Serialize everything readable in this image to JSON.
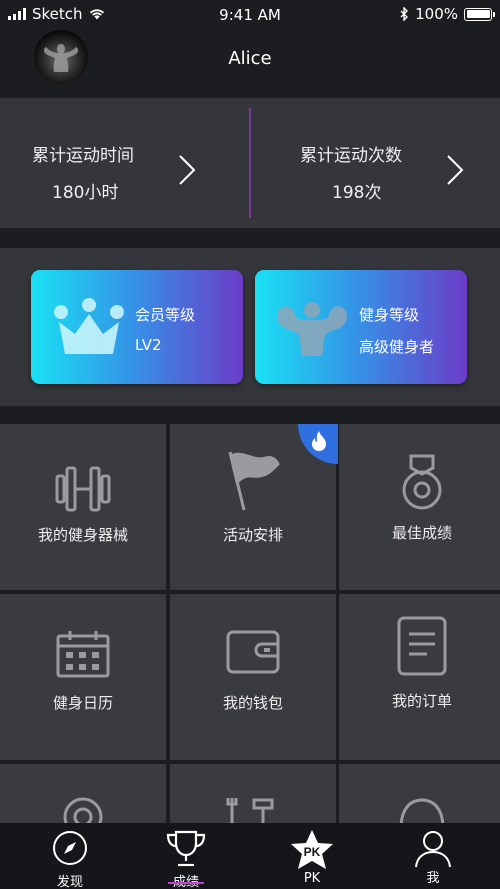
{
  "status_bar": {
    "carrier": "Sketch",
    "time": "9:41 AM",
    "battery": "100%"
  },
  "profile": {
    "name": "Alice"
  },
  "stats": [
    {
      "label": "累计运动时间",
      "value": "180小时"
    },
    {
      "label": "累计运动次数",
      "value": "198次"
    }
  ],
  "levels": [
    {
      "label": "会员等级",
      "value": "LV2",
      "icon": "crown-icon"
    },
    {
      "label": "健身等级",
      "value": "高级健身者",
      "icon": "bodybuilder-icon"
    }
  ],
  "grid": [
    {
      "label": "我的健身器械",
      "icon": "dumbbell-icon"
    },
    {
      "label": "活动安排",
      "icon": "flag-icon"
    },
    {
      "label": "最佳成绩",
      "icon": "medal-icon"
    },
    {
      "label": "健身日历",
      "icon": "calendar-icon"
    },
    {
      "label": "我的钱包",
      "icon": "wallet-icon"
    },
    {
      "label": "我的订单",
      "icon": "order-icon"
    }
  ],
  "tabs": [
    {
      "label": "发现",
      "icon": "compass-icon"
    },
    {
      "label": "成绩",
      "icon": "trophy-icon",
      "active": true
    },
    {
      "label": "PK",
      "icon": "pk-star-icon"
    },
    {
      "label": "我",
      "icon": "person-icon"
    }
  ],
  "colors": {
    "accent_purple": "#7a3aa0",
    "tab_underline": "#c43fd7",
    "card_gradient_start": "#19e1f3",
    "card_gradient_end": "#6b3cc8",
    "hot_badge": "#2f6fe0"
  }
}
